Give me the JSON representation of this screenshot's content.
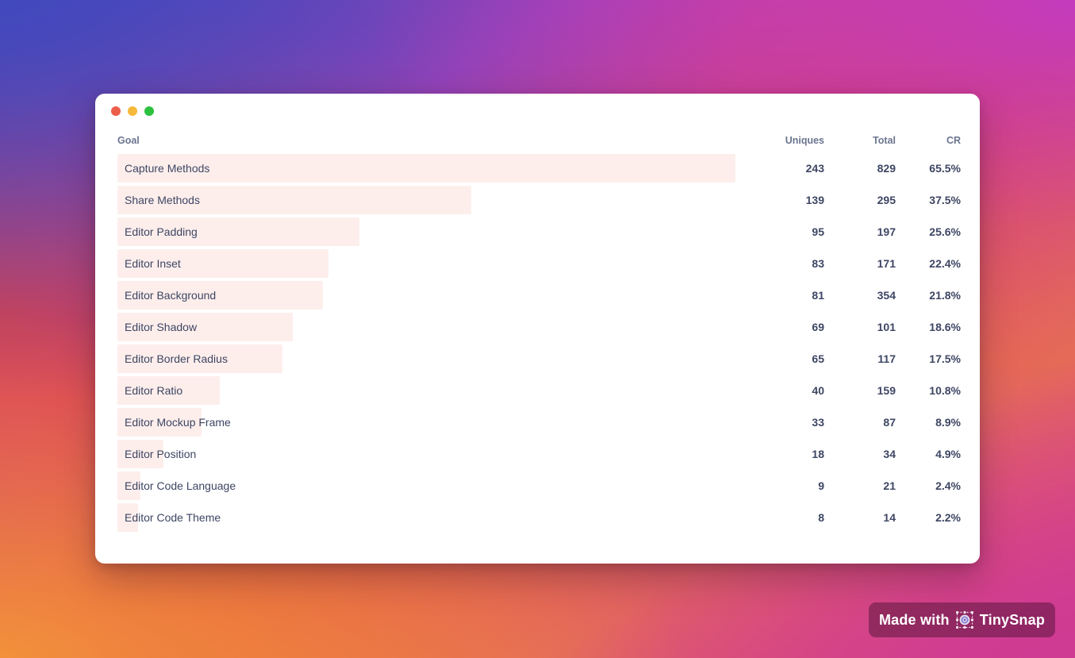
{
  "window": {
    "traffic_lights": [
      {
        "name": "close",
        "color": "#ed5f4b"
      },
      {
        "name": "minimize",
        "color": "#f6b93c"
      },
      {
        "name": "maximize",
        "color": "#2cc03f"
      }
    ]
  },
  "table": {
    "columns": {
      "goal": "Goal",
      "uniques": "Uniques",
      "total": "Total",
      "cr": "CR"
    },
    "bar_color": "#fdeeec",
    "text_color": "#3d4663",
    "header_color": "#6b7590",
    "rows": [
      {
        "goal": "Capture Methods",
        "uniques": "243",
        "total": "829",
        "cr": "65.5%",
        "bar_pct": 100.0
      },
      {
        "goal": "Share Methods",
        "uniques": "139",
        "total": "295",
        "cr": "37.5%",
        "bar_pct": 57.2
      },
      {
        "goal": "Editor Padding",
        "uniques": "95",
        "total": "197",
        "cr": "25.6%",
        "bar_pct": 39.1
      },
      {
        "goal": "Editor Inset",
        "uniques": "83",
        "total": "171",
        "cr": "22.4%",
        "bar_pct": 34.2
      },
      {
        "goal": "Editor Background",
        "uniques": "81",
        "total": "354",
        "cr": "21.8%",
        "bar_pct": 33.3
      },
      {
        "goal": "Editor Shadow",
        "uniques": "69",
        "total": "101",
        "cr": "18.6%",
        "bar_pct": 28.4
      },
      {
        "goal": "Editor Border Radius",
        "uniques": "65",
        "total": "117",
        "cr": "17.5%",
        "bar_pct": 26.7
      },
      {
        "goal": "Editor Ratio",
        "uniques": "40",
        "total": "159",
        "cr": "10.8%",
        "bar_pct": 16.5
      },
      {
        "goal": "Editor Mockup Frame",
        "uniques": "33",
        "total": "87",
        "cr": "8.9%",
        "bar_pct": 13.6
      },
      {
        "goal": "Editor Position",
        "uniques": "18",
        "total": "34",
        "cr": "4.9%",
        "bar_pct": 7.4
      },
      {
        "goal": "Editor Code Language",
        "uniques": "9",
        "total": "21",
        "cr": "2.4%",
        "bar_pct": 3.7
      },
      {
        "goal": "Editor Code Theme",
        "uniques": "8",
        "total": "14",
        "cr": "2.2%",
        "bar_pct": 3.3
      }
    ]
  },
  "badge": {
    "prefix": "Made with",
    "brand": "TinySnap",
    "logo_icon": "tinysnap-logo-icon"
  },
  "chart_data": {
    "type": "bar",
    "title": "",
    "xlabel": "Uniques",
    "ylabel": "Goal",
    "categories": [
      "Capture Methods",
      "Share Methods",
      "Editor Padding",
      "Editor Inset",
      "Editor Background",
      "Editor Shadow",
      "Editor Border Radius",
      "Editor Ratio",
      "Editor Mockup Frame",
      "Editor Position",
      "Editor Code Language",
      "Editor Code Theme"
    ],
    "series": [
      {
        "name": "Uniques",
        "values": [
          243,
          139,
          95,
          83,
          81,
          69,
          65,
          40,
          33,
          18,
          9,
          8
        ]
      },
      {
        "name": "Total",
        "values": [
          829,
          295,
          197,
          171,
          354,
          101,
          117,
          159,
          87,
          34,
          21,
          14
        ]
      },
      {
        "name": "CR",
        "values": [
          65.5,
          37.5,
          25.6,
          22.4,
          21.8,
          18.6,
          17.5,
          10.8,
          8.9,
          4.9,
          2.4,
          2.2
        ]
      }
    ],
    "bar_series": "Uniques",
    "xlim": [
      0,
      243
    ],
    "grid": false,
    "legend": "none",
    "orientation": "horizontal"
  }
}
